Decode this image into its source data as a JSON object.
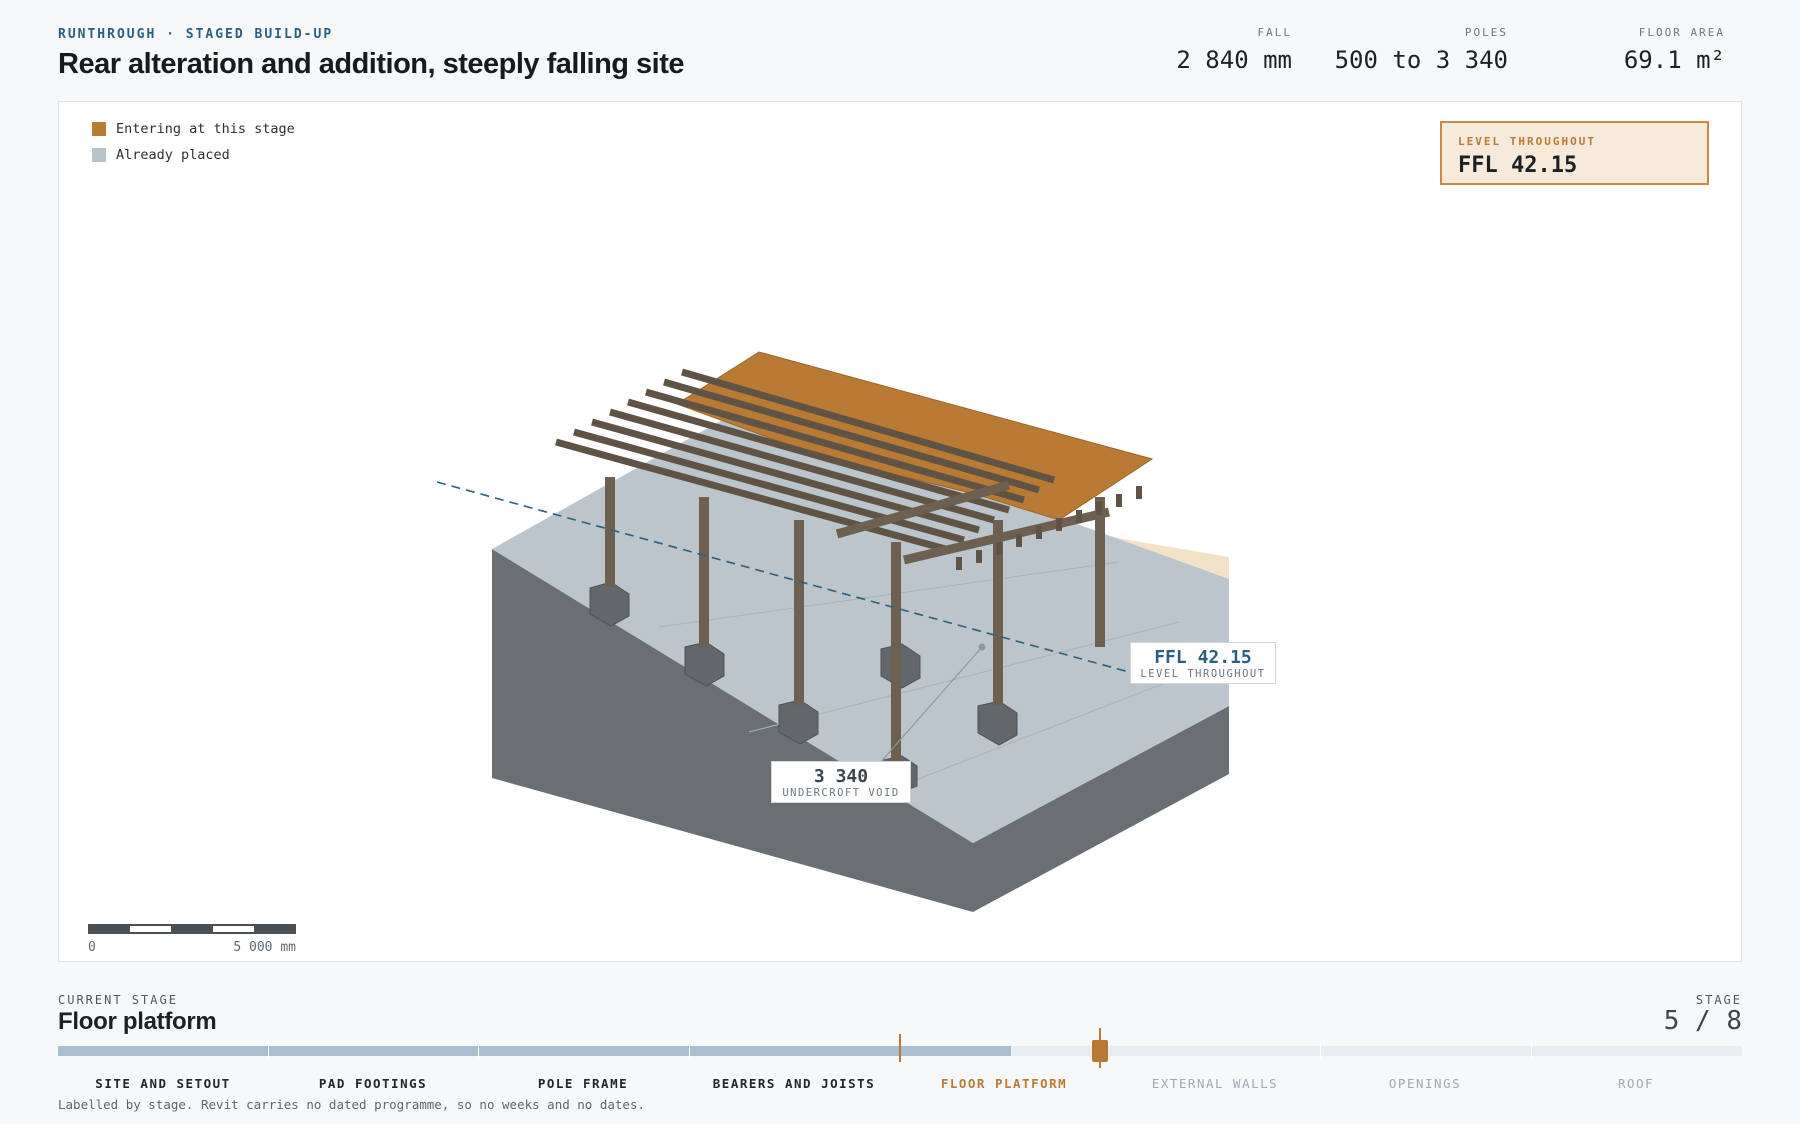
{
  "header": {
    "eyebrow": "RUNTHROUGH · STAGED BUILD-UP",
    "title": "Rear alteration and addition, steeply falling site",
    "stats": [
      {
        "label": "FALL",
        "value": "2 840 mm"
      },
      {
        "label": "POLES",
        "value": "500 to 3 340"
      },
      {
        "label": "FLOOR AREA",
        "value": "69.1 m²"
      }
    ]
  },
  "legend": {
    "entering": {
      "label": "Entering at this stage",
      "color": "#b97a33"
    },
    "placed": {
      "label": "Already placed",
      "color": "#b8c2ca"
    }
  },
  "level_card": {
    "label": "LEVEL THROUGHOUT",
    "value": "FFL 42.15"
  },
  "callouts": {
    "ffl": {
      "value": "FFL 42.15",
      "caption": "LEVEL THROUGHOUT"
    },
    "void": {
      "value": "3 340",
      "caption": "UNDERCROFT VOID"
    }
  },
  "scale": {
    "start": "0",
    "end": "5 000 mm"
  },
  "footer": {
    "current_label": "CURRENT STAGE",
    "current_value": "Floor platform",
    "stage_label": "STAGE",
    "stage_value": "5 / 8",
    "stage_current": 5,
    "stage_total": 8,
    "steps": [
      "SITE AND SETOUT",
      "PAD FOOTINGS",
      "POLE FRAME",
      "BEARERS AND JOISTS",
      "FLOOR PLATFORM",
      "EXTERNAL WALLS",
      "OPENINGS",
      "ROOF"
    ],
    "note": "Labelled by stage. Revit carries no dated programme, so no weeks and no dates."
  },
  "colors": {
    "accent": "#b97a33",
    "placed": "#b8c2ca",
    "timber": "#6e6050",
    "ground_dark": "#6a6f73",
    "level_line": "#2b5f80"
  }
}
